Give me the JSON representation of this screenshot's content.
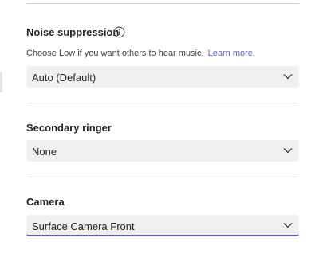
{
  "noise": {
    "title": "Noise suppression",
    "hint": "Choose Low if you want others to hear music.",
    "link": "Learn more.",
    "value": "Auto (Default)",
    "info_icon": "info-icon"
  },
  "ringer": {
    "title": "Secondary ringer",
    "value": "None"
  },
  "camera": {
    "title": "Camera",
    "value": "Surface Camera Front"
  },
  "colors": {
    "accent": "#5b5fc7",
    "field_bg": "#f0f0f0",
    "divider": "#d1d1d1"
  },
  "icons": {
    "dropdown": "chevron-down-icon"
  }
}
